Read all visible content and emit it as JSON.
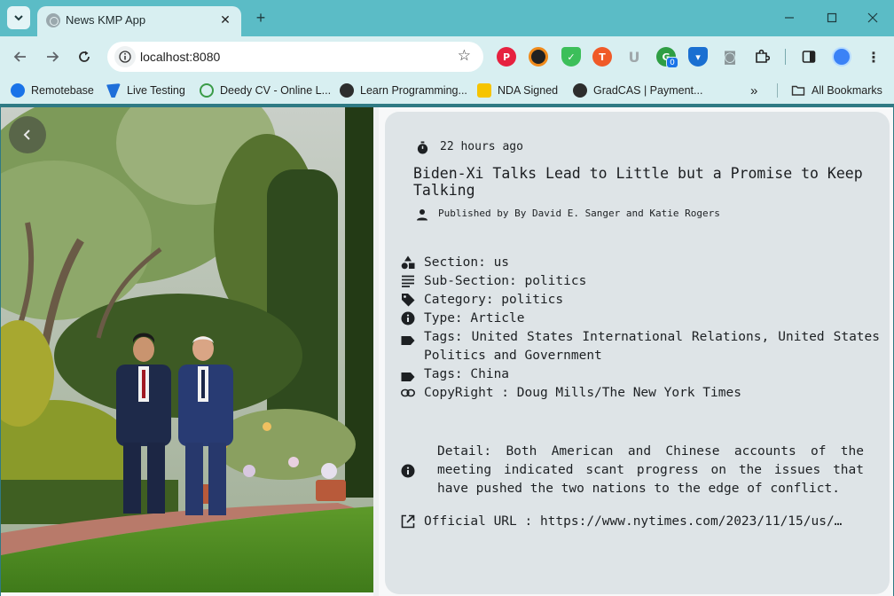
{
  "browser": {
    "tab_title": "News KMP App",
    "url": "localhost:8080",
    "bookmarks": [
      {
        "label": "Remotebase"
      },
      {
        "label": "Live Testing"
      },
      {
        "label": "Deedy CV - Online L..."
      },
      {
        "label": "Learn Programming..."
      },
      {
        "label": "NDA Signed"
      },
      {
        "label": "GradCAS | Payment..."
      }
    ],
    "all_bookmarks_label": "All Bookmarks",
    "extension_badge": "0"
  },
  "article": {
    "time_ago": "22 hours ago",
    "title": "Biden-Xi Talks Lead to Little but a Promise to Keep Talking",
    "published_by": "Published by By David E. Sanger and Katie Rogers",
    "section": "Section: us",
    "sub_section": "Sub-Section: politics",
    "category": "Category: politics",
    "type": "Type: Article",
    "tags_1": "Tags: United States International Relations, United States Politics and Government",
    "tags_2": "Tags: China",
    "copyright": "CopyRight : Doug Mills/The New York Times",
    "detail": "Detail: Both American and Chinese accounts of the meeting indicated scant progress on the issues that have pushed the two nations to the edge of conflict.",
    "official_url": "Official URL : https://www.nytimes.com/2023/11/15/us/…"
  },
  "colors": {
    "tabstrip": "#5bbcc6",
    "toolbar": "#d8eff1",
    "card": "#dee4e7"
  }
}
